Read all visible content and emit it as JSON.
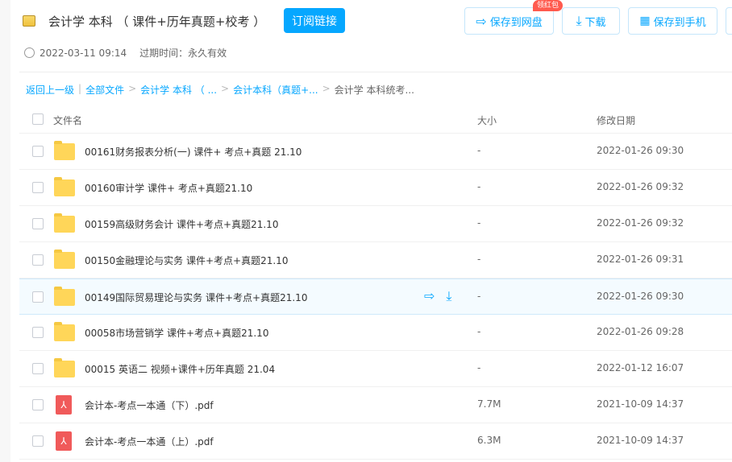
{
  "header": {
    "title": "会计学 本科 （ 课件+历年真题+校考 ）",
    "subscribe": "订阅链接",
    "save_pan": "保存到网盘",
    "badge": "领红包",
    "download": "下载",
    "save_phone": "保存到手机",
    "time": "2022-03-11 09:14",
    "expire": "过期时间：永久有效"
  },
  "breadcrumb": {
    "back": "返回上一级",
    "all": "全部文件",
    "c1": "会计学 本科 （ ...",
    "c2": "会计本科（真题+...",
    "current": "会计学 本科统考..."
  },
  "columns": {
    "name": "文件名",
    "size": "大小",
    "date": "修改日期"
  },
  "rows": [
    {
      "name": "00161财务报表分析(一) 课件+ 考点+真题 21.10",
      "size": "-",
      "date": "2022-01-26 09:30"
    },
    {
      "name": "00160审计学 课件+ 考点+真题21.10",
      "size": "-",
      "date": "2022-01-26 09:32"
    },
    {
      "name": "00159高级财务会计 课件+考点+真题21.10",
      "size": "-",
      "date": "2022-01-26 09:32"
    },
    {
      "name": "00150金融理论与实务 课件+考点+真题21.10",
      "size": "-",
      "date": "2022-01-26 09:31"
    },
    {
      "name": "00149国际贸易理论与实务 课件+考点+真题21.10",
      "size": "-",
      "date": "2022-01-26 09:30"
    },
    {
      "name": "00058市场营销学 课件+考点+真题21.10",
      "size": "-",
      "date": "2022-01-26 09:28"
    },
    {
      "name": "00015 英语二 视频+课件+历年真题 21.04",
      "size": "-",
      "date": "2022-01-12 16:07"
    },
    {
      "name": "会计本-考点一本通（下）.pdf",
      "size": "7.7M",
      "date": "2021-10-09 14:37"
    },
    {
      "name": "会计本-考点一本通（上）.pdf",
      "size": "6.3M",
      "date": "2021-10-09 14:37"
    }
  ]
}
